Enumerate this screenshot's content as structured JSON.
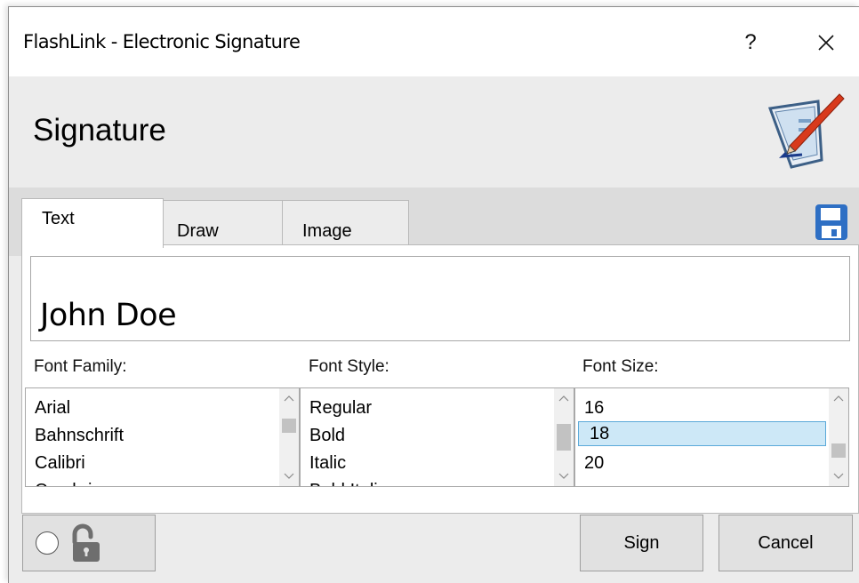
{
  "window": {
    "title": "FlashLink - Electronic Signature",
    "help_label": "?",
    "close_icon": "close-icon"
  },
  "header": {
    "title": "Signature",
    "icon": "signature-pen-icon"
  },
  "tabs": [
    {
      "label": "Text",
      "active": true
    },
    {
      "label": "Draw",
      "active": false
    },
    {
      "label": "Image",
      "active": false
    }
  ],
  "toolbar": {
    "save_icon": "save-disk-icon"
  },
  "preview": {
    "text": "John Doe"
  },
  "font_family": {
    "label": "Font Family:",
    "items": [
      "Arial",
      "Bahnschrift",
      "Calibri",
      "Cambria"
    ],
    "selected": null
  },
  "font_style": {
    "label": "Font Style:",
    "items": [
      "Regular",
      "Bold",
      "Italic",
      "Bold Italic"
    ],
    "selected": null
  },
  "font_size": {
    "label": "Font Size:",
    "items": [
      "16",
      "18",
      "20"
    ],
    "selected": "18"
  },
  "buttons": {
    "sign": "Sign",
    "cancel": "Cancel",
    "lock_icon": "unlock-icon",
    "radio_icon": "radio-icon"
  },
  "colors": {
    "selection_bg": "#cde8f7",
    "selection_border": "#5aa9d9",
    "save_icon_blue": "#2e6fc4",
    "pen_red": "#d83a1c"
  }
}
